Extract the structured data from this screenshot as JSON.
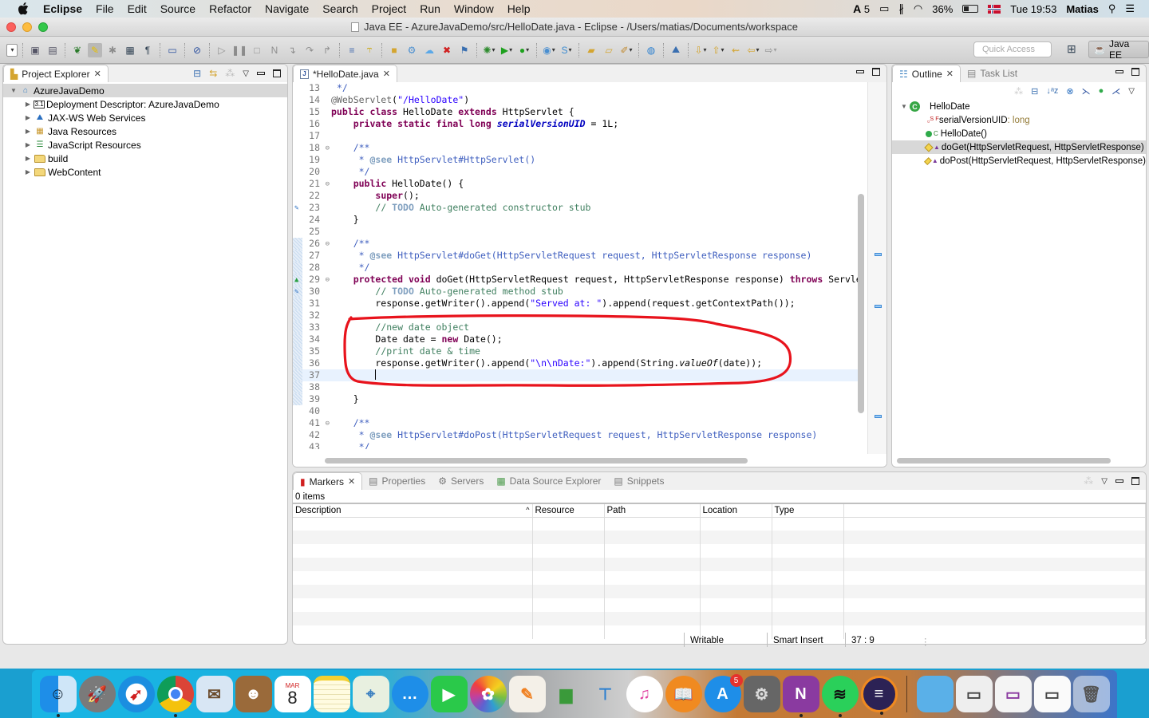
{
  "menubar": {
    "app_name": "Eclipse",
    "items": [
      "File",
      "Edit",
      "Source",
      "Refactor",
      "Navigate",
      "Search",
      "Project",
      "Run",
      "Window",
      "Help"
    ],
    "status": {
      "adobe_count": "5",
      "battery": "36%",
      "clock": "Tue 19:53",
      "user": "Matias"
    }
  },
  "window": {
    "title": "Java EE - AzureJavaDemo/src/HelloDate.java - Eclipse - /Users/matias/Documents/workspace"
  },
  "toolbar": {
    "quick_access_placeholder": "Quick Access",
    "perspective": "Java EE"
  },
  "project_explorer": {
    "tab_label": "Project Explorer",
    "root": "AzureJavaDemo",
    "children": [
      {
        "label": "Deployment Descriptor: AzureJavaDemo",
        "icon": "deployment-descriptor-icon"
      },
      {
        "label": "JAX-WS Web Services",
        "icon": "web-services-icon"
      },
      {
        "label": "Java Resources",
        "icon": "java-resources-icon"
      },
      {
        "label": "JavaScript Resources",
        "icon": "javascript-resources-icon"
      },
      {
        "label": "build",
        "icon": "folder-icon"
      },
      {
        "label": "WebContent",
        "icon": "folder-icon"
      }
    ]
  },
  "editor": {
    "tab_label": "*HelloDate.java",
    "current_line": 37,
    "lines": [
      {
        "n": 13,
        "html": " <span class=\"jdoc\">*/</span>"
      },
      {
        "n": 14,
        "html": "<span class=\"ann\">@WebServlet</span>(<span class=\"str\">\"/HelloDate\"</span>)"
      },
      {
        "n": 15,
        "html": "<span class=\"kw\">public</span> <span class=\"kw\">class</span> HelloDate <span class=\"kw\">extends</span> HttpServlet {"
      },
      {
        "n": 16,
        "html": "    <span class=\"kw\">private</span> <span class=\"kw\">static</span> <span class=\"kw\">final</span> <span class=\"kw\">long</span> <span class=\"fld\">serialVersionUID</span> = 1L;"
      },
      {
        "n": 17,
        "html": ""
      },
      {
        "n": 18,
        "fold": true,
        "html": "    <span class=\"jdoc\">/**</span>"
      },
      {
        "n": 19,
        "html": "<span class=\"jdoc\">     * <span class=\"jtag\">@see</span> HttpServlet#HttpServlet()</span>"
      },
      {
        "n": 20,
        "html": "<span class=\"jdoc\">     */</span>"
      },
      {
        "n": 21,
        "fold": true,
        "html": "    <span class=\"kw\">public</span> HelloDate() {"
      },
      {
        "n": 22,
        "html": "        <span class=\"kw\">super</span>();"
      },
      {
        "n": 23,
        "task": true,
        "html": "        <span class=\"cmt\">// <span class=\"todo\">TODO</span> Auto-generated constructor stub</span>"
      },
      {
        "n": 24,
        "html": "    }"
      },
      {
        "n": 25,
        "html": ""
      },
      {
        "n": 26,
        "fold": true,
        "changed": true,
        "html": "    <span class=\"jdoc\">/**</span>"
      },
      {
        "n": 27,
        "changed": true,
        "html": "<span class=\"jdoc\">     * <span class=\"jtag\">@see</span> HttpServlet#doGet(HttpServletRequest request, HttpServletResponse response)</span>"
      },
      {
        "n": 28,
        "changed": true,
        "html": "<span class=\"jdoc\">     */</span>"
      },
      {
        "n": 29,
        "fold": true,
        "override": true,
        "changed": true,
        "html": "    <span class=\"kw\">protected</span> <span class=\"kw\">void</span> doGet(HttpServletRequest request, HttpServletResponse response) <span class=\"kw\">throws</span> ServletException, IOException {"
      },
      {
        "n": 30,
        "task": true,
        "changed": true,
        "html": "        <span class=\"cmt\">// <span class=\"todo\">TODO</span> Auto-generated method stub</span>"
      },
      {
        "n": 31,
        "changed": true,
        "html": "        response.getWriter().append(<span class=\"str\">\"Served at: \"</span>).append(request.getContextPath());"
      },
      {
        "n": 32,
        "changed": true,
        "html": ""
      },
      {
        "n": 33,
        "changed": true,
        "html": "        <span class=\"cmt\">//new date object</span>"
      },
      {
        "n": 34,
        "changed": true,
        "html": "        Date date = <span class=\"kw\">new</span> Date();"
      },
      {
        "n": 35,
        "changed": true,
        "html": "        <span class=\"cmt\">//print date &amp; time</span>"
      },
      {
        "n": 36,
        "changed": true,
        "html": "        response.getWriter().append(<span class=\"str\">\"\\n\\nDate:\"</span>).append(String.<span class=\"ital\">valueOf</span>(date));"
      },
      {
        "n": 37,
        "changed": true,
        "html": "        <span class=\"caret\"></span>"
      },
      {
        "n": 38,
        "changed": true,
        "html": ""
      },
      {
        "n": 39,
        "changed": true,
        "html": "    }"
      },
      {
        "n": 40,
        "html": ""
      },
      {
        "n": 41,
        "fold": true,
        "html": "    <span class=\"jdoc\">/**</span>"
      },
      {
        "n": 42,
        "html": "<span class=\"jdoc\">     * <span class=\"jtag\">@see</span> HttpServlet#doPost(HttpServletRequest request, HttpServletResponse response)</span>"
      },
      {
        "n": 43,
        "html": "<span class=\"jdoc\">     */</span>"
      }
    ]
  },
  "outline": {
    "tab_label": "Outline",
    "tab2_label": "Task List",
    "class_name": "HelloDate",
    "members": [
      {
        "name": "serialVersionUID",
        "type": " : long",
        "kind": "field",
        "mods": "S F"
      },
      {
        "name": "HelloDate()",
        "type": "",
        "kind": "constructor",
        "mods": "C"
      },
      {
        "name": "doGet(HttpServletRequest, HttpServletResponse)",
        "type": "",
        "kind": "protected-method",
        "selected": true
      },
      {
        "name": "doPost(HttpServletRequest, HttpServletResponse)",
        "type": "",
        "kind": "protected-method"
      }
    ]
  },
  "bottom_panel": {
    "tabs": [
      {
        "label": "Markers",
        "active": true
      },
      {
        "label": "Properties"
      },
      {
        "label": "Servers"
      },
      {
        "label": "Data Source Explorer"
      },
      {
        "label": "Snippets"
      }
    ],
    "items_count": "0 items",
    "columns": [
      "Description",
      "Resource",
      "Path",
      "Location",
      "Type"
    ]
  },
  "statusbar": {
    "writable": "Writable",
    "insert_mode": "Smart Insert",
    "position": "37 : 9"
  },
  "dock": {
    "calendar_month": "MAR",
    "calendar_day": "8",
    "app_store_badge": "5",
    "apps": [
      "Finder",
      "Launchpad",
      "Safari",
      "Chrome",
      "Mail",
      "Contacts",
      "Calendar",
      "Notes",
      "Maps",
      "Messages",
      "FaceTime",
      "Photos",
      "Pages",
      "Numbers",
      "Keynote",
      "iTunes",
      "iBooks",
      "App Store",
      "System Preferences",
      "OneNote",
      "Spotify",
      "Eclipse",
      "Downloads",
      "Chrome window",
      "OneNote window",
      "Finder window",
      "Trash"
    ]
  }
}
